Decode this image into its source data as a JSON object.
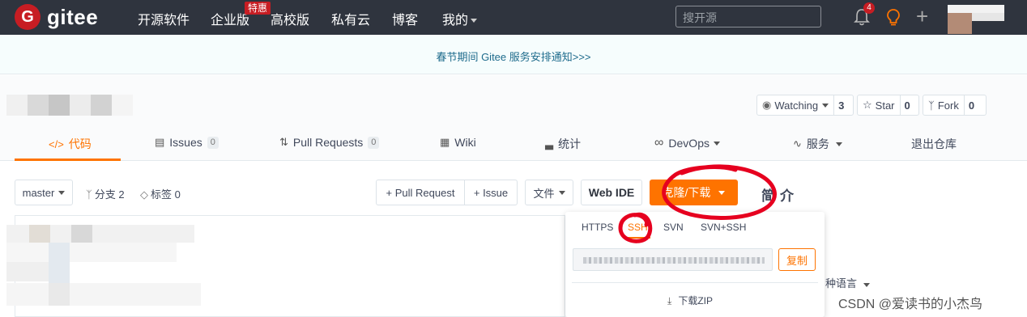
{
  "topbar": {
    "logo_letter": "G",
    "logo_text": "gitee",
    "nav": [
      "开源软件",
      "企业版",
      "高校版",
      "私有云",
      "博客",
      "我的"
    ],
    "hot_badge": "特惠",
    "search_placeholder": "搜开源",
    "notification_count": "4"
  },
  "banner": {
    "text": "春节期间 Gitee 服务安排通知>>>"
  },
  "repo_actions": {
    "watching_label": "Watching",
    "watching_count": "3",
    "star_label": "Star",
    "star_count": "0",
    "fork_label": "Fork",
    "fork_count": "0"
  },
  "tabs": [
    {
      "label": "代码",
      "icon": "</>"
    },
    {
      "label": "Issues",
      "count": "0"
    },
    {
      "label": "Pull Requests",
      "count": "0"
    },
    {
      "label": "Wiki"
    },
    {
      "label": "统计"
    },
    {
      "label": "DevOps"
    },
    {
      "label": "服务"
    },
    {
      "label": "退出仓库"
    }
  ],
  "toolbar": {
    "branch": "master",
    "branches_label": "分支 2",
    "tags_label": "标签 0",
    "pull_request_btn": "+ Pull Request",
    "issue_btn": "+ Issue",
    "file_btn": "文件",
    "webide_btn": "Web IDE",
    "clone_btn": "克隆/下载",
    "intro": "简介"
  },
  "clone_dropdown": {
    "protocols": [
      "HTTPS",
      "SSH",
      "SVN",
      "SVN+SSH"
    ],
    "active_protocol": "SSH",
    "copy_label": "复制",
    "download_zip": "下载ZIP"
  },
  "languages_label": "种语言",
  "watermark": "CSDN @爱读书的小杰鸟",
  "colors": {
    "accent": "#fe7300",
    "topbar": "#2f343e",
    "brand": "#c71d23",
    "annotation": "#e6001f"
  }
}
